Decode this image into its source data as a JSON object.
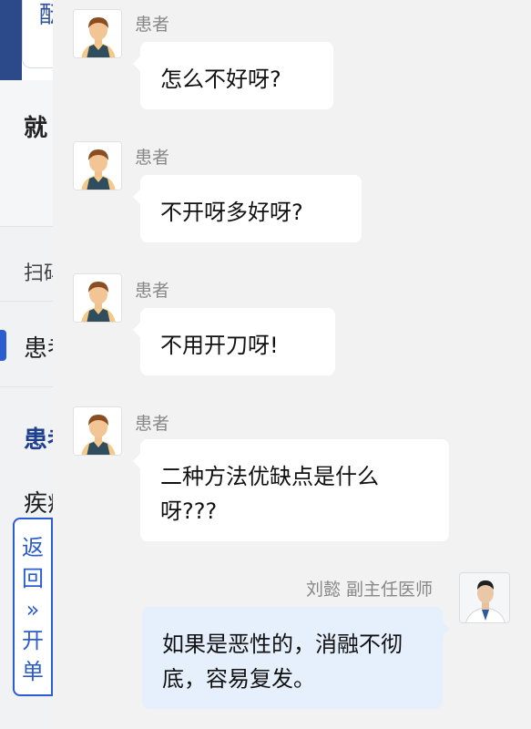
{
  "background": {
    "top_card_text": "酝",
    "item_1": "就",
    "item_2": "扫码",
    "item_3": "患者",
    "item_4": "患者",
    "item_5": "疾病"
  },
  "return_button": {
    "line1": "返",
    "line2": "回",
    "line3": "»",
    "line4": "开",
    "line5": "单"
  },
  "messages": [
    {
      "sender": "患者",
      "text": "怎么不好呀?"
    },
    {
      "sender": "患者",
      "text": "不开呀多好呀?"
    },
    {
      "sender": "患者",
      "text": "不用开刀呀!"
    },
    {
      "sender": "患者",
      "text": "二种方法优缺点是什么呀???"
    },
    {
      "sender": "刘懿 副主任医师",
      "text": "如果是恶性的，消融不彻底，容易复发。"
    }
  ],
  "colors": {
    "accent": "#2b5cd1",
    "doctor_bubble": "#e6effc",
    "patient_bubble": "#ffffff"
  }
}
